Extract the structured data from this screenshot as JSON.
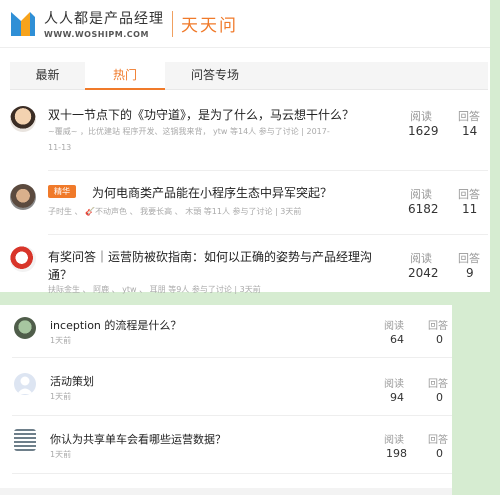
{
  "header": {
    "logo_cn": "人人都是产品经理",
    "logo_en": "WWW.WOSHIPM.COM",
    "channel": "天天问"
  },
  "tabs": [
    {
      "label": "最新"
    },
    {
      "label": "热门"
    },
    {
      "label": "问答专场"
    }
  ],
  "stat_labels": {
    "views": "阅读",
    "answers": "回答"
  },
  "top_questions": [
    {
      "title": "双十一节点下的《功守道》，是为了什么，马云想干什么？",
      "meta": "~覆威~ ，比优建站 程序开发、这锅我来背， ytw 等14人 参与了讨论 | 2017-",
      "meta2": "11-13",
      "views": "1629",
      "answers": "14"
    },
    {
      "badge": "精华",
      "title": "为何电商类产品能在小程序生态中异军突起？",
      "meta": "子时生 、 🎸不动声色 、 我要长高 、 木頭 等11人 参与了讨论 | 3天前",
      "views": "6182",
      "answers": "11"
    },
    {
      "title": "有奖问答｜运营防被砍指南：如何以正确的姿势与产品经理沟",
      "title2": "通？",
      "meta": "扶际金生 、 阿鹿 、 ytw 、 耳朋 等9人 参与了讨论 | 3天前",
      "views": "2042",
      "answers": "9"
    }
  ],
  "bottom_questions": [
    {
      "title": "inception 的流程是什么？",
      "time": "1天前",
      "views": "64",
      "answers": "0"
    },
    {
      "title": "活动策划",
      "time": "1天前",
      "views": "94",
      "answers": "0"
    },
    {
      "title": "你认为共享单车会看哪些运营数据？",
      "time": "1天前",
      "views": "198",
      "answers": "0"
    }
  ],
  "colors": {
    "accent": "#f07a2a",
    "background": "#d6ecd1"
  }
}
